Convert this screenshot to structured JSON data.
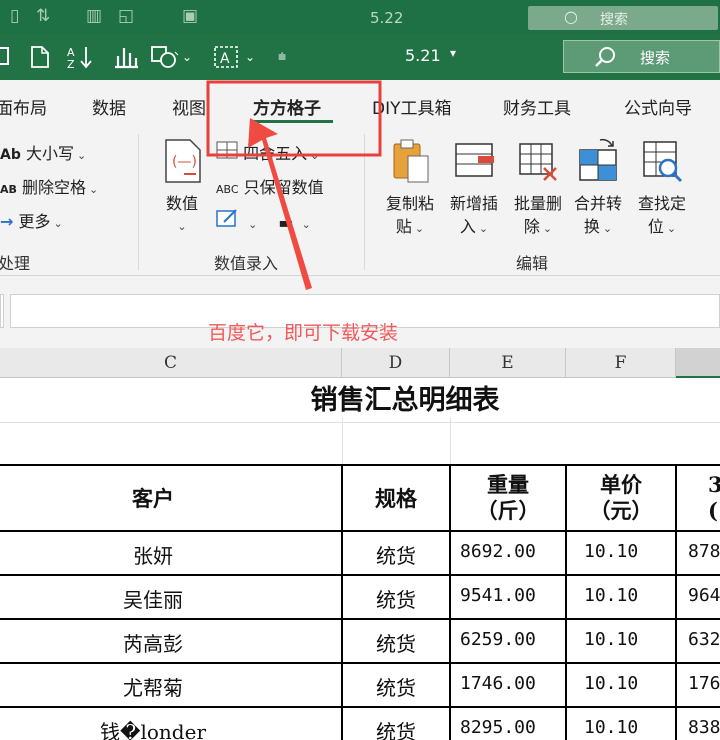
{
  "ghost_bar": {
    "title": "5.22",
    "search_label": "搜索"
  },
  "title_bar": {
    "doc_title": "5.21",
    "search_label": "搜索"
  },
  "tabs": [
    {
      "label": "面布局"
    },
    {
      "label": "数据"
    },
    {
      "label": "视图"
    },
    {
      "label": "方方格子",
      "active": true
    },
    {
      "label": "DIY工具箱"
    },
    {
      "label": "财务工具"
    },
    {
      "label": "公式向导"
    }
  ],
  "ribbon": {
    "text_group": {
      "items": [
        "大小写",
        "删除空格",
        "更多"
      ],
      "icon_text": [
        "Ab",
        "AB"
      ],
      "label": "处理"
    },
    "number_group": {
      "big_button": "数值",
      "items": [
        "四舍五入",
        "只保留数值",
        ""
      ],
      "icon_text": "ABC",
      "label": "数值录入"
    },
    "edit_group": {
      "buttons": [
        {
          "line1": "复制粘",
          "line2": "贴"
        },
        {
          "line1": "新增插",
          "line2": "入"
        },
        {
          "line1": "批量删",
          "line2": "除"
        },
        {
          "line1": "合并转",
          "line2": "换"
        },
        {
          "line1": "查找定",
          "line2": "位"
        }
      ],
      "label": "编辑"
    }
  },
  "annotation": "百度它，即可下载安装",
  "columns": [
    "C",
    "D",
    "E",
    "F"
  ],
  "sheet": {
    "title": "销售汇总明细表",
    "headers": {
      "customer": "客户",
      "spec": "规格",
      "weight_l1": "重量",
      "weight_l2": "（斤）",
      "price_l1": "单价",
      "price_l2": "（元）",
      "next_l1": "3",
      "next_l2": "("
    },
    "rows": [
      {
        "customer": "张妍",
        "spec": "统货",
        "weight": "8692.00",
        "price": "10.10",
        "amount": "878"
      },
      {
        "customer": "吴佳丽",
        "spec": "统货",
        "weight": "9541.00",
        "price": "10.10",
        "amount": "964"
      },
      {
        "customer": "芮高彭",
        "spec": "统货",
        "weight": "6259.00",
        "price": "10.10",
        "amount": "632"
      },
      {
        "customer": "尤帮菊",
        "spec": "统货",
        "weight": "1746.00",
        "price": "10.10",
        "amount": "176"
      },
      {
        "customer": "钱�londer",
        "spec": "统货",
        "weight": "8295.00",
        "price": "10.10",
        "amount": "838"
      }
    ]
  },
  "colors": {
    "excel_green": "#217346",
    "annotation_red": "#e8403f"
  }
}
